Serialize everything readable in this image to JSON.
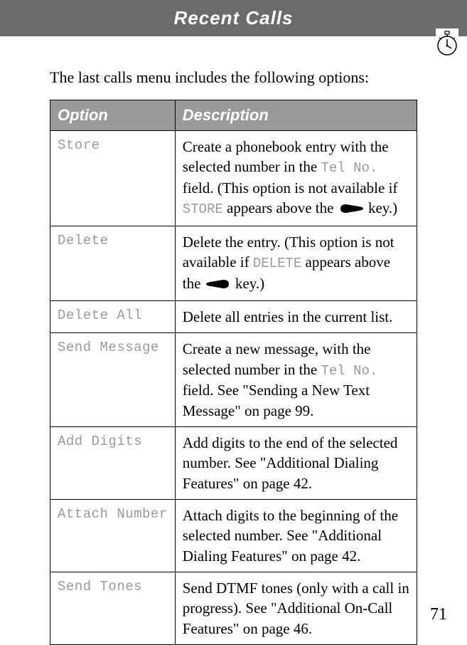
{
  "header": {
    "title": "Recent Calls"
  },
  "intro": "The last calls menu includes the following options:",
  "table": {
    "headers": {
      "option": "Option",
      "description": "Description"
    },
    "rows": [
      {
        "option": "Store",
        "desc_pre": "Create a phonebook entry with the selected number in the ",
        "desc_mono1": "Tel No.",
        "desc_mid1": " field. (This option is not available if ",
        "desc_mono2": "STORE",
        "desc_mid2": " appears above the ",
        "desc_post": " key.)",
        "icon": "right"
      },
      {
        "option": "Delete",
        "desc_pre": "Delete the entry. (This option is not available if ",
        "desc_mono1": "DELETE",
        "desc_mid1": " appears above the ",
        "desc_post": " key.)",
        "icon": "left"
      },
      {
        "option": "Delete All",
        "desc_plain": "Delete all entries in the current list."
      },
      {
        "option": "Send Message",
        "desc_pre": "Create a new message, with the selected number in the ",
        "desc_mono1": "Tel No.",
        "desc_post": " field. See \"Sending a New Text Message\" on page 99."
      },
      {
        "option": "Add Digits",
        "desc_plain": "Add digits to the end of the selected number. See \"Additional Dialing Features\" on page 42."
      },
      {
        "option": "Attach Number",
        "desc_plain": "Attach digits to the beginning of the selected number. See \"Additional Dialing Features\" on page 42."
      },
      {
        "option": "Send Tones",
        "desc_plain": "Send DTMF tones (only with a call in progress). See \"Additional On-Call Features\" on page 46."
      }
    ]
  },
  "page_number": "71"
}
